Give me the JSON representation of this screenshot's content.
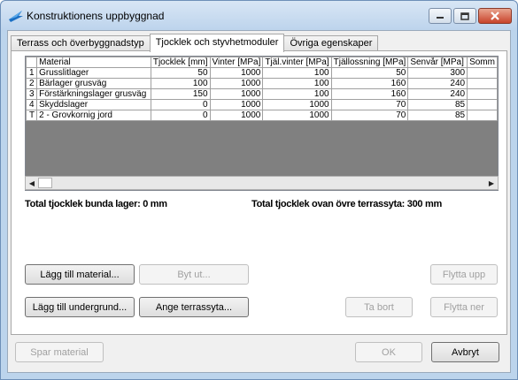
{
  "window": {
    "title": "Konstruktionens uppbyggnad"
  },
  "tabs": [
    {
      "label": "Terrass och överbyggnadstyp"
    },
    {
      "label": "Tjocklek och styvhetmoduler"
    },
    {
      "label": "Övriga egenskaper"
    }
  ],
  "grid": {
    "columns": [
      "Material",
      "Tjocklek [mm]",
      "Vinter [MPa]",
      "Tjäl.vinter [MPa]",
      "Tjällossning [MPa]",
      "Senvår [MPa]",
      "Somm"
    ],
    "rows": [
      {
        "marker": "1",
        "material": "Grusslitlager",
        "tjocklek": "50",
        "vinter": "1000",
        "tjalvinter": "100",
        "tjallossning": "50",
        "senvar": "300"
      },
      {
        "marker": "2",
        "material": "Bärlager grusväg",
        "tjocklek": "100",
        "vinter": "1000",
        "tjalvinter": "100",
        "tjallossning": "160",
        "senvar": "240"
      },
      {
        "marker": "3",
        "material": "Förstärkningslager grusväg",
        "tjocklek": "150",
        "vinter": "1000",
        "tjalvinter": "100",
        "tjallossning": "160",
        "senvar": "240"
      },
      {
        "marker": "4",
        "material": "Skyddslager",
        "tjocklek": "0",
        "vinter": "1000",
        "tjalvinter": "1000",
        "tjallossning": "70",
        "senvar": "85"
      },
      {
        "marker": "T",
        "material": "2 - Grovkornig jord",
        "tjocklek": "0",
        "vinter": "1000",
        "tjalvinter": "1000",
        "tjallossning": "70",
        "senvar": "85"
      }
    ]
  },
  "totals": {
    "bottom_label": "Total tjocklek bunda lager: 0 mm",
    "top_label": "Total tjocklek ovan övre terrassyta:  300 mm"
  },
  "buttons": {
    "add_material": "Lägg till material...",
    "replace": "Byt ut...",
    "move_up": "Flytta upp",
    "add_subgrade": "Lägg till undergrund...",
    "set_terrace": "Ange terrassyta...",
    "remove": "Ta bort",
    "move_down": "Flytta ner",
    "save_material": "Spar material",
    "ok": "OK",
    "cancel": "Avbryt"
  },
  "icons": {
    "app": "app-icon",
    "minimize": "minimize-icon",
    "maximize": "maximize-icon",
    "close": "close-icon"
  }
}
